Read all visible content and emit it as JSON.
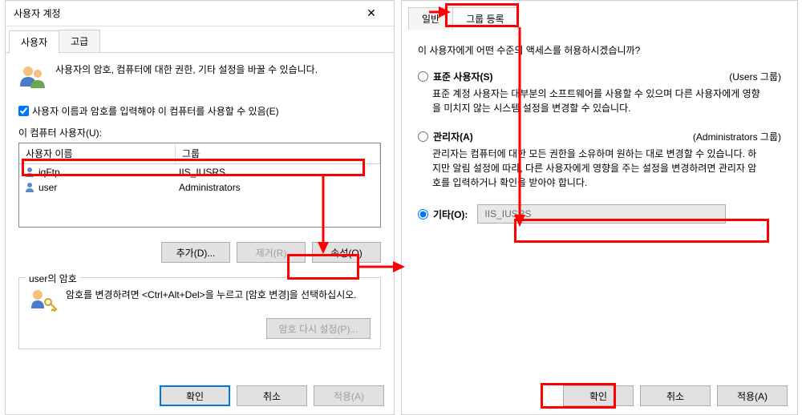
{
  "left": {
    "title": "사용자 계정",
    "tabs": {
      "users": "사용자",
      "advanced": "고급"
    },
    "info_text": "사용자의 암호, 컴퓨터에 대한 권한, 기타 설정을 바꿀 수 있습니다.",
    "checkbox_label": "사용자 이름과 암호를 입력해야 이 컴퓨터를 사용할 수 있음(E)",
    "users_label": "이 컴퓨터 사용자(U):",
    "table": {
      "col_name": "사용자 이름",
      "col_group": "그룹",
      "rows": [
        {
          "name": "iqFtp",
          "group": "IIS_IUSRS"
        },
        {
          "name": "user",
          "group": "Administrators"
        }
      ]
    },
    "buttons": {
      "add": "추가(D)...",
      "remove": "제거(R)",
      "properties": "속성(O)"
    },
    "password_section": {
      "legend": "user의 암호",
      "text": "암호를 변경하려면 <Ctrl+Alt+Del>을 누르고 [암호 변경]을 선택하십시오.",
      "reset_btn": "암호 다시 설정(P)..."
    },
    "dialog_buttons": {
      "ok": "확인",
      "cancel": "취소",
      "apply": "적용(A)"
    }
  },
  "right": {
    "tabs": {
      "general": "일반",
      "group": "그룹 등록"
    },
    "prompt": "이 사용자에게 어떤 수준의 액세스를 허용하시겠습니까?",
    "options": {
      "standard": {
        "label": "표준 사용자(S)",
        "hint": "(Users 그룹)",
        "desc": "표준 계정 사용자는 대부분의 소프트웨어를 사용할 수 있으며 다른 사용자에게 영향을 미치지 않는 시스템 설정을 변경할 수 있습니다."
      },
      "admin": {
        "label": "관리자(A)",
        "hint": "(Administrators 그룹)",
        "desc": "관리자는 컴퓨터에 대한 모든 권한을 소유하며 원하는 대로 변경할 수 있습니다. 하지만 알림 설정에 따라, 다른 사용자에게 영향을 주는 설정을 변경하려면 관리자 암호를 입력하거나 확인을 받아야 합니다."
      },
      "other": {
        "label": "기타(O):",
        "value": "IIS_IUSRS"
      }
    },
    "dialog_buttons": {
      "ok": "확인",
      "cancel": "취소",
      "apply": "적용(A)"
    }
  }
}
